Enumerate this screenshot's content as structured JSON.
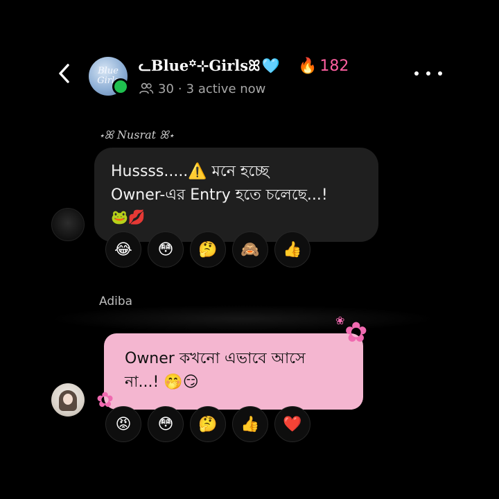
{
  "header": {
    "group_name": "ᓚBlue꙳⊹Girlsꕤ",
    "heart": "🩵",
    "streak_icon": "🔥",
    "streak_count": "182",
    "members_icon": "members-icon",
    "member_count": "30",
    "separator": "·",
    "active_status": "3 active now",
    "avatar_text": "Blue\nGirls",
    "online_color": "#1fbf4f"
  },
  "messages": [
    {
      "sender": "⋆ꕤ Nusrat ꕤ⋆",
      "lines": [
        "Hussss.....⚠️ মনে হচ্ছে",
        "Owner-এর Entry হতে চলেছে...!"
      ],
      "emojis": "🐸💋",
      "reactions": [
        "😂",
        "😳",
        "🤔",
        "🙈",
        "👍"
      ],
      "bubble_color": "#1f1f1f"
    },
    {
      "sender": "Adiba",
      "lines": [
        "Owner কখনো এভাবে আসে",
        "না...! 🤭😏"
      ],
      "reactions": [
        "😡",
        "😳",
        "🤔",
        "👍",
        "❤️"
      ],
      "bubble_color": "#f4b6d0",
      "decorations": [
        "✿",
        "❀",
        "✿"
      ]
    }
  ]
}
